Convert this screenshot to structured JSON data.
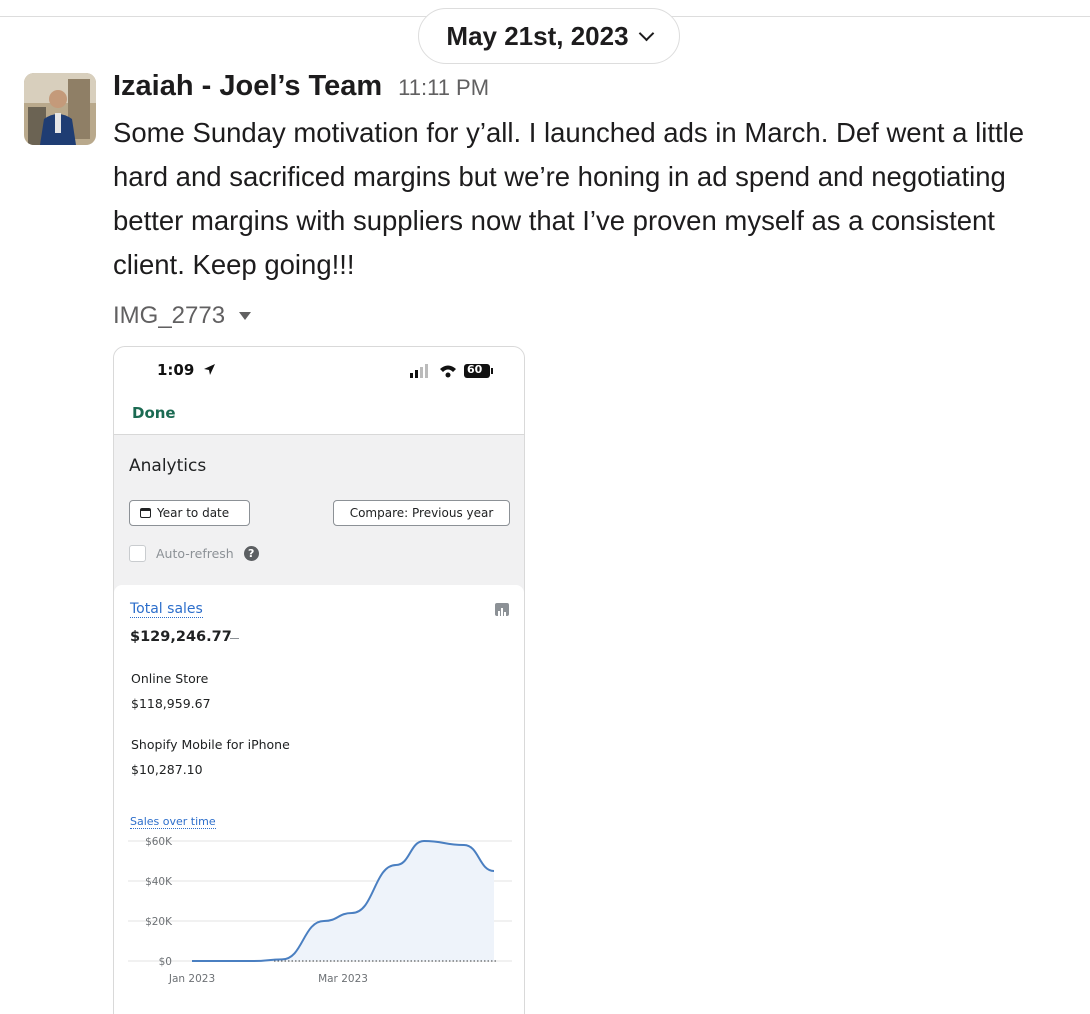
{
  "date_divider": {
    "label": "May 21st, 2023"
  },
  "message": {
    "sender": "Izaiah - Joel’s Team",
    "time": "11:11 PM",
    "body": "Some Sunday motivation for y’all. I launched ads in March. Def went a little hard and sacrificed margins but we’re honing in ad spend and negotiating better margins with suppliers now that I’ve proven myself as a consistent client. Keep going!!!",
    "attachment_name": "IMG_2773"
  },
  "screenshot": {
    "status_time": "1:09",
    "battery": "60",
    "done_label": "Done",
    "title": "Analytics",
    "date_range_button": "Year to date",
    "compare_button": "Compare: Previous year",
    "auto_refresh_label": "Auto-refresh",
    "help_glyph": "?",
    "total_sales_label": "Total sales",
    "total_sales_value": "$129,246.77",
    "channels": [
      {
        "name": "Online Store",
        "value": "$118,959.67"
      },
      {
        "name": "Shopify Mobile for iPhone",
        "value": "$10,287.10"
      }
    ],
    "chart_title": "Sales over time"
  },
  "chart_data": {
    "type": "line",
    "title": "Sales over time",
    "y_ticks": [
      "$60K",
      "$40K",
      "$20K",
      "$0"
    ],
    "x_ticks": [
      "Jan 2023",
      "Mar 2023"
    ],
    "ylim": [
      0,
      60000
    ],
    "series": [
      {
        "values": [
          {
            "x": "Jan 2023",
            "y": 0
          },
          {
            "x": "Feb 2023",
            "y": 0
          },
          {
            "x": "Feb 2023 (late)",
            "y": 800
          },
          {
            "x": "Mar 2023",
            "y": 20000
          },
          {
            "x": "Mar 2023 (late)",
            "y": 24000
          },
          {
            "x": "Apr 2023",
            "y": 48000
          },
          {
            "x": "Apr 2023 (late)",
            "y": 60000
          },
          {
            "x": "May 2023",
            "y": 58000
          },
          {
            "x": "May 2023 (late)",
            "y": 45000
          }
        ]
      },
      {
        "values": [
          {
            "x": "Jan 2023",
            "y": 0
          },
          {
            "x": "May 2023 (late)",
            "y": 0
          }
        ]
      }
    ],
    "grid": true,
    "legend": "none",
    "colors": {
      "current": "#4a7fc1",
      "previous": "#5c5f62"
    }
  }
}
